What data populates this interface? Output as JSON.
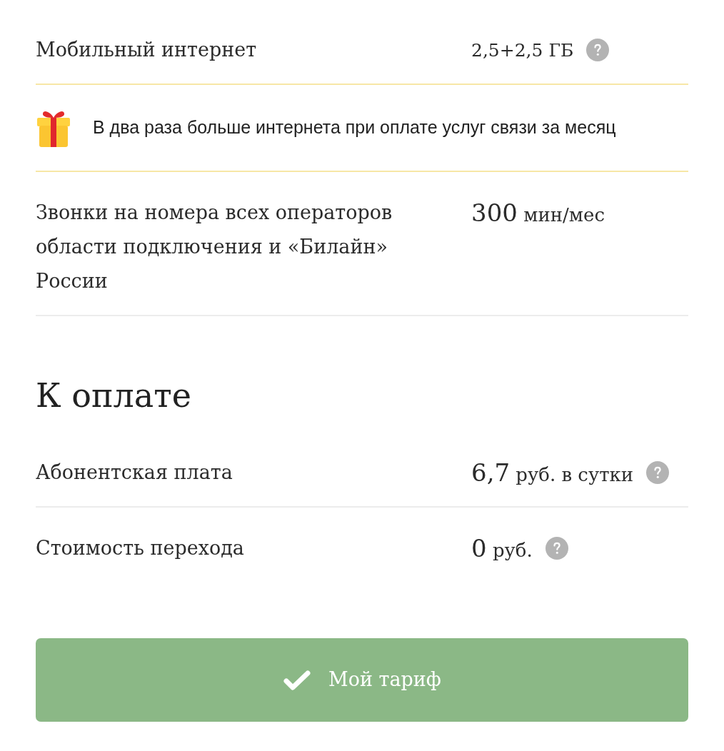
{
  "features": [
    {
      "kind": "row",
      "label": "Мобильный интернет",
      "amount": "2,5+2,5 ГБ",
      "help": true
    },
    {
      "kind": "promo",
      "text": "В два раза больше интернета при оплате услуг связи за месяц"
    },
    {
      "kind": "row",
      "label": "Звонки на номера всех операторов области подключения и «Билайн» России",
      "amount": "300",
      "unit": "мин/мес",
      "help": false
    }
  ],
  "payment": {
    "title": "К оплате",
    "rows": [
      {
        "label": "Абонентская плата",
        "amount": "6,7",
        "unit": "руб. в сутки",
        "help": true
      },
      {
        "label": "Стоимость перехода",
        "amount": "0",
        "unit": "руб.",
        "help": true
      }
    ]
  },
  "button": {
    "label": "Мой тариф",
    "current": true
  }
}
